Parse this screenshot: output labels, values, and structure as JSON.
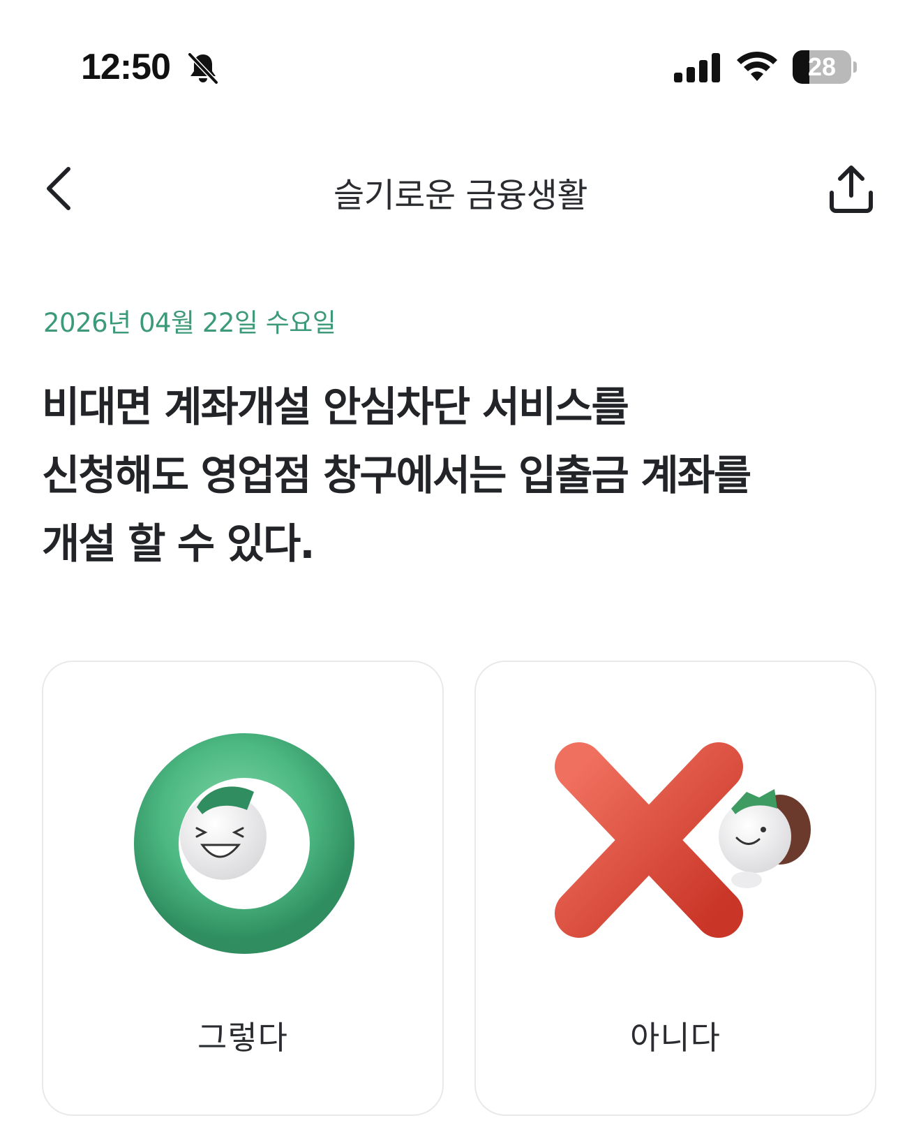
{
  "status_bar": {
    "time": "12:50",
    "battery_level": "28",
    "icons": [
      "bell-slash-icon",
      "cellular-signal-icon",
      "wifi-icon",
      "battery-icon"
    ]
  },
  "nav": {
    "title": "슬기로운 금융생활",
    "back_icon": "chevron-left-icon",
    "share_icon": "share-icon"
  },
  "quiz": {
    "date": "2026년 04월 22일 수요일",
    "question_lines": [
      "비대면 계좌개설 안심차단 서비스를",
      "신청해도 영업점 창구에서는 입출금 계좌를",
      "개설 할 수 있다."
    ]
  },
  "answers": [
    {
      "label": "그렇다",
      "icon": "o-ring-character-icon",
      "color": "#4cb882"
    },
    {
      "label": "아니다",
      "icon": "x-mark-character-icon",
      "color": "#e24a3b"
    }
  ]
}
